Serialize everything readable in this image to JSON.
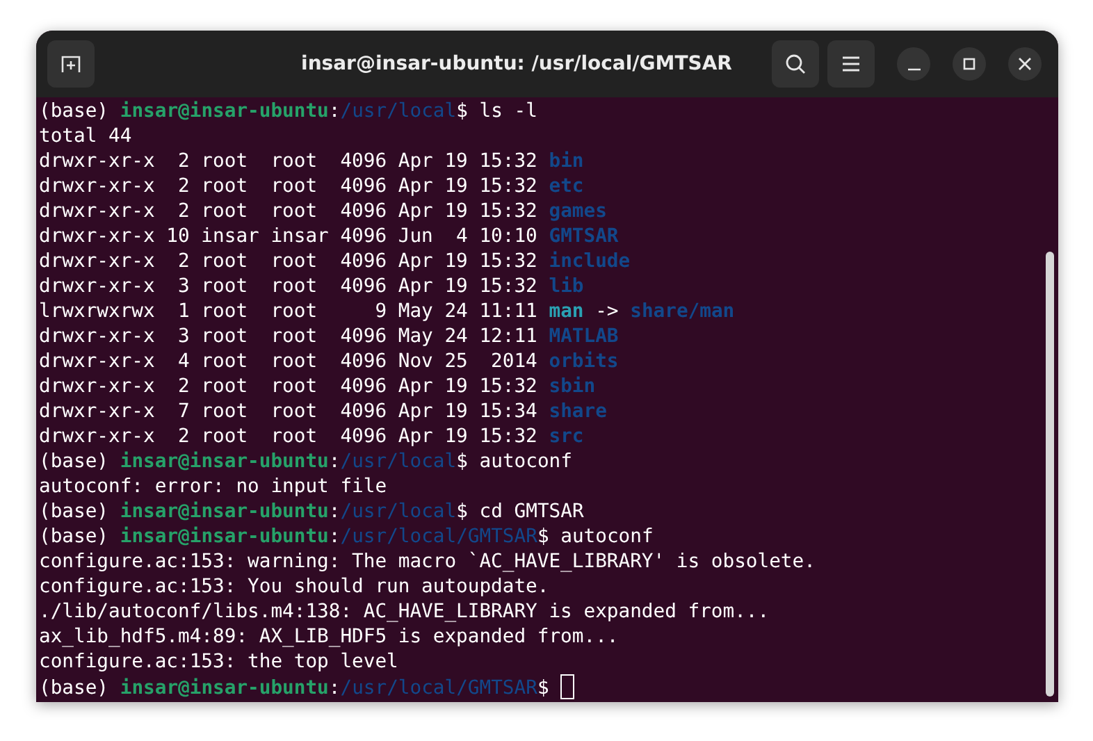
{
  "window": {
    "title": "insar@insar-ubuntu: /usr/local/GMTSAR"
  },
  "terminal": {
    "lines": [
      {
        "kind": "prompt",
        "env": "(base)",
        "user": "insar@insar-ubuntu",
        "sep": ":",
        "path": "/usr/local",
        "sigil": "$",
        "command": "ls -l",
        "cursor": false
      },
      {
        "kind": "output",
        "text": "total 44"
      },
      {
        "kind": "listing",
        "meta": "drwxr-xr-x  2 root  root  4096 Apr 19 15:32",
        "name": "bin"
      },
      {
        "kind": "listing",
        "meta": "drwxr-xr-x  2 root  root  4096 Apr 19 15:32",
        "name": "etc"
      },
      {
        "kind": "listing",
        "meta": "drwxr-xr-x  2 root  root  4096 Apr 19 15:32",
        "name": "games"
      },
      {
        "kind": "listing",
        "meta": "drwxr-xr-x 10 insar insar 4096 Jun  4 10:10",
        "name": "GMTSAR"
      },
      {
        "kind": "listing",
        "meta": "drwxr-xr-x  2 root  root  4096 Apr 19 15:32",
        "name": "include"
      },
      {
        "kind": "listing",
        "meta": "drwxr-xr-x  3 root  root  4096 Apr 19 15:32",
        "name": "lib"
      },
      {
        "kind": "symlink",
        "meta": "lrwxrwxrwx  1 root  root     9 May 24 11:11",
        "name": "man",
        "arrow": "->",
        "target": "share/man"
      },
      {
        "kind": "listing",
        "meta": "drwxr-xr-x  3 root  root  4096 May 24 12:11",
        "name": "MATLAB"
      },
      {
        "kind": "listing",
        "meta": "drwxr-xr-x  4 root  root  4096 Nov 25  2014",
        "name": "orbits"
      },
      {
        "kind": "listing",
        "meta": "drwxr-xr-x  2 root  root  4096 Apr 19 15:32",
        "name": "sbin"
      },
      {
        "kind": "listing",
        "meta": "drwxr-xr-x  7 root  root  4096 Apr 19 15:34",
        "name": "share"
      },
      {
        "kind": "listing",
        "meta": "drwxr-xr-x  2 root  root  4096 Apr 19 15:32",
        "name": "src"
      },
      {
        "kind": "prompt",
        "env": "(base)",
        "user": "insar@insar-ubuntu",
        "sep": ":",
        "path": "/usr/local",
        "sigil": "$",
        "command": "autoconf",
        "cursor": false
      },
      {
        "kind": "output",
        "text": "autoconf: error: no input file"
      },
      {
        "kind": "prompt",
        "env": "(base)",
        "user": "insar@insar-ubuntu",
        "sep": ":",
        "path": "/usr/local",
        "sigil": "$",
        "command": "cd GMTSAR",
        "cursor": false
      },
      {
        "kind": "prompt",
        "env": "(base)",
        "user": "insar@insar-ubuntu",
        "sep": ":",
        "path": "/usr/local/GMTSAR",
        "sigil": "$",
        "command": "autoconf",
        "cursor": false
      },
      {
        "kind": "output",
        "text": "configure.ac:153: warning: The macro `AC_HAVE_LIBRARY' is obsolete."
      },
      {
        "kind": "output",
        "text": "configure.ac:153: You should run autoupdate."
      },
      {
        "kind": "output",
        "text": "./lib/autoconf/libs.m4:138: AC_HAVE_LIBRARY is expanded from..."
      },
      {
        "kind": "output",
        "text": "ax_lib_hdf5.m4:89: AX_LIB_HDF5 is expanded from..."
      },
      {
        "kind": "output",
        "text": "configure.ac:153: the top level"
      },
      {
        "kind": "prompt",
        "env": "(base)",
        "user": "insar@insar-ubuntu",
        "sep": ":",
        "path": "/usr/local/GMTSAR",
        "sigil": "$",
        "cursor": true
      }
    ]
  }
}
